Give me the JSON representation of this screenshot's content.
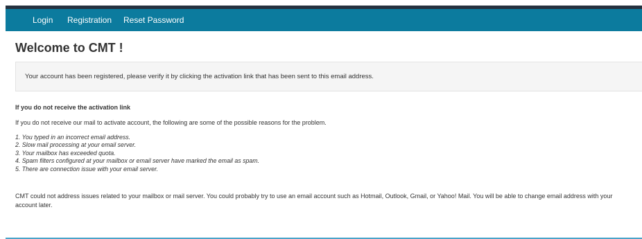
{
  "nav": {
    "items": [
      "Login",
      "Registration",
      "Reset Password"
    ]
  },
  "page": {
    "title": "Welcome to CMT !"
  },
  "alert": {
    "message": "Your account has been registered, please verify it by clicking the activation link that has been sent to this email address."
  },
  "help": {
    "heading": "If you do not receive the activation link",
    "intro": "If you do not receive our mail to activate account, the following are some of the possible reasons for the problem.",
    "reasons": [
      "1. You typed in an incorrect email address.",
      "2. Slow mail processing at your email server.",
      "3. Your mailbox has exceeded quota.",
      "4. Spam filters configured at your mailbox or email server have marked the email as spam.",
      "5. There are connection issue with your email server."
    ],
    "advice": "CMT could not address issues related to your mailbox or mail server. You could probably try to use an email account such as Hotmail, Outlook, Gmail, or Yahoo! Mail. You will be able to change email address with your account later."
  },
  "colors": {
    "navbar": "#0c7b9e",
    "topbar": "#25313f",
    "alert_bg": "#f5f5f5",
    "footer_line": "#4aa3c8"
  }
}
